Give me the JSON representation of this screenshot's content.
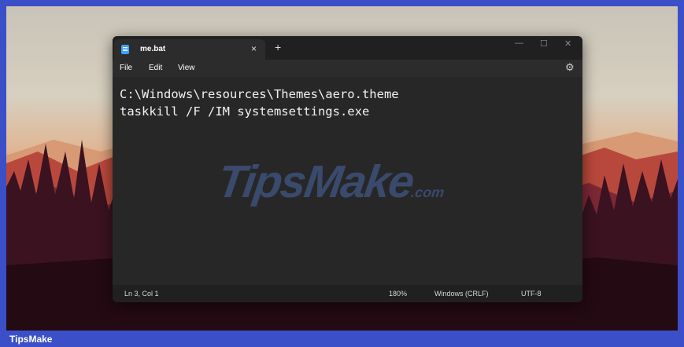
{
  "window": {
    "tab_title": "me.bat",
    "tab_close": "×",
    "new_tab": "+",
    "minimize": "—",
    "maximize": "☐",
    "close": "✕"
  },
  "menu": [
    "File",
    "Edit",
    "View"
  ],
  "settings_icon": "⚙",
  "editor": {
    "lines": [
      "C:\\Windows\\resources\\Themes\\aero.theme",
      "taskkill /F /IM systemsettings.exe"
    ]
  },
  "watermark": {
    "main": "TipsMake",
    "suffix": ".com"
  },
  "status": {
    "position": "Ln 3, Col 1",
    "zoom": "180%",
    "line_ending": "Windows (CRLF)",
    "encoding": "UTF-8"
  },
  "footer": {
    "brand": "TipsMake"
  }
}
